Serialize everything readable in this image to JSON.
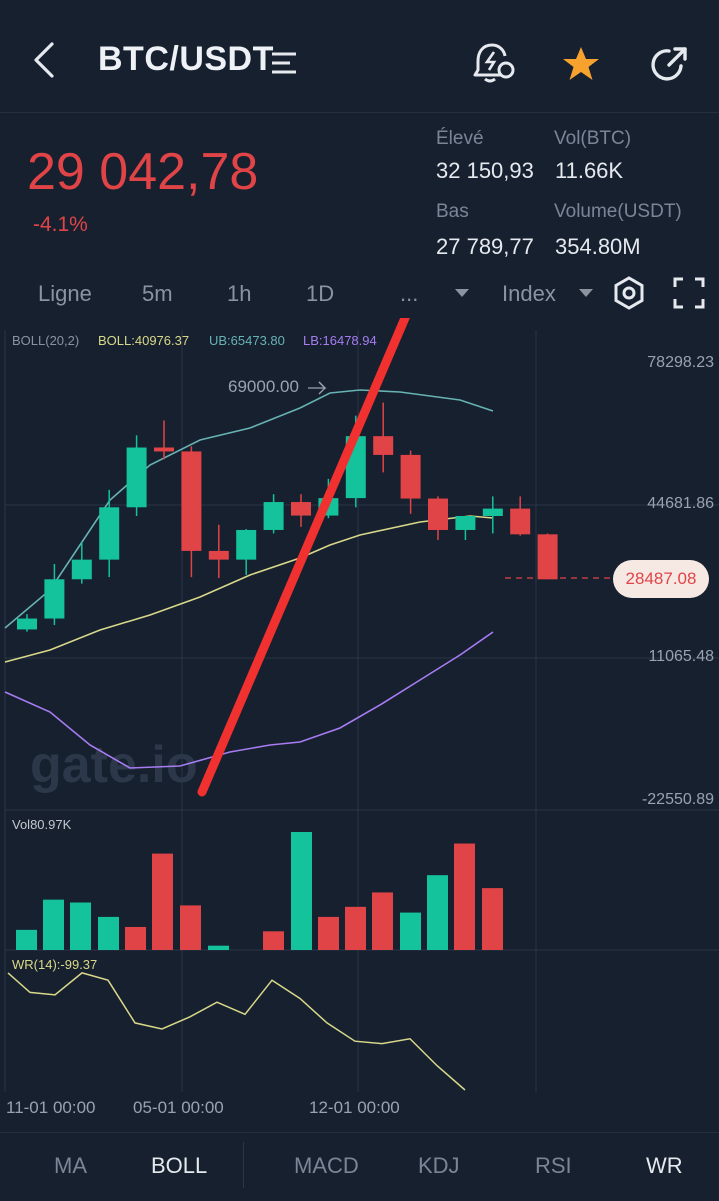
{
  "header": {
    "pair": "BTC/USDT",
    "back_icon": "chevron-left-icon",
    "menu_icon": "list-filter-icon",
    "alert_icon": "alarm-bell-icon",
    "favorite_icon": "star-icon",
    "share_icon": "share-icon"
  },
  "ticker": {
    "price": "29 042,78",
    "change": "-4.1%",
    "stats": {
      "high_label": "Élevé",
      "high_value": "32 150,93",
      "vol_btc_label": "Vol(BTC)",
      "vol_btc_value": "11.66K",
      "low_label": "Bas",
      "low_value": "27 789,77",
      "vol_usdt_label": "Volume(USDT)",
      "vol_usdt_value": "354.80M"
    }
  },
  "timeframes": {
    "line": "Ligne",
    "m5": "5m",
    "h1": "1h",
    "d1": "1D",
    "more": "...",
    "index": "Index"
  },
  "chart_data": [
    {
      "type": "candlestick",
      "title": "",
      "indicator": {
        "name": "BOLL(20,2)",
        "boll": "BOLL:40976.37",
        "ub": "UB:65473.80",
        "lb": "LB:16478.94"
      },
      "y_axis_labels": [
        "78298.23",
        "44681.86",
        "11065.48",
        "-22550.89"
      ],
      "max_marker": "69000.00",
      "current_price_label": "28487.08",
      "x_labels": [
        "11-01 00:00",
        "05-01 00:00",
        "12-01 00:00"
      ],
      "ylim": [
        -22550.89,
        78298.23
      ],
      "candles": [
        {
          "o": 17000,
          "h": 20500,
          "l": 16500,
          "c": 19500
        },
        {
          "o": 19500,
          "h": 32000,
          "l": 18000,
          "c": 28500
        },
        {
          "o": 28500,
          "h": 37000,
          "l": 27500,
          "c": 33000
        },
        {
          "o": 33000,
          "h": 49000,
          "l": 29000,
          "c": 45000
        },
        {
          "o": 45000,
          "h": 61500,
          "l": 43000,
          "c": 58700
        },
        {
          "o": 58700,
          "h": 64900,
          "l": 56000,
          "c": 57800
        },
        {
          "o": 57800,
          "h": 59000,
          "l": 29000,
          "c": 35000
        },
        {
          "o": 35000,
          "h": 41000,
          "l": 28800,
          "c": 33000
        },
        {
          "o": 33000,
          "h": 40000,
          "l": 29500,
          "c": 39800
        },
        {
          "o": 39800,
          "h": 48000,
          "l": 39000,
          "c": 46200
        },
        {
          "o": 46200,
          "h": 48000,
          "l": 40500,
          "c": 43100
        },
        {
          "o": 43100,
          "h": 51500,
          "l": 42500,
          "c": 47100
        },
        {
          "o": 47100,
          "h": 66000,
          "l": 45000,
          "c": 61300
        },
        {
          "o": 61300,
          "h": 69000,
          "l": 53000,
          "c": 57000
        },
        {
          "o": 57000,
          "h": 58000,
          "l": 43500,
          "c": 47000
        },
        {
          "o": 47000,
          "h": 47500,
          "l": 37500,
          "c": 39800
        },
        {
          "o": 39800,
          "h": 43000,
          "l": 37500,
          "c": 43000
        },
        {
          "o": 43000,
          "h": 47500,
          "l": 39000,
          "c": 44700
        },
        {
          "o": 44700,
          "h": 47500,
          "l": 38500,
          "c": 38800
        },
        {
          "o": 38800,
          "h": 39000,
          "l": 28500,
          "c": 28487
        }
      ]
    },
    {
      "type": "bar",
      "title": "",
      "label": "Vol80.97K",
      "values": [
        14,
        35,
        33,
        23,
        16,
        67,
        31,
        3,
        13,
        82,
        23,
        30,
        40,
        26,
        52,
        74,
        43
      ]
    },
    {
      "type": "line",
      "title": "",
      "label": "WR(14):-99.37",
      "values": [
        -4,
        -20,
        -22,
        -4,
        -10,
        -45,
        -50,
        -40,
        -28,
        -38,
        -10,
        -25,
        -45,
        -60,
        -62,
        -58,
        -80,
        -100
      ]
    }
  ],
  "indicator_tabs": [
    "MA",
    "BOLL",
    "MACD",
    "KDJ",
    "RSI",
    "WR"
  ],
  "watermark": "gate.io",
  "colors": {
    "background": "#16202f",
    "down": "#e04447",
    "up": "#14c29b",
    "boll_mid": "#d9d88a",
    "boll_upper": "#67b2b3",
    "boll_lower": "#a77cf2",
    "favorite": "#f7a22e"
  }
}
